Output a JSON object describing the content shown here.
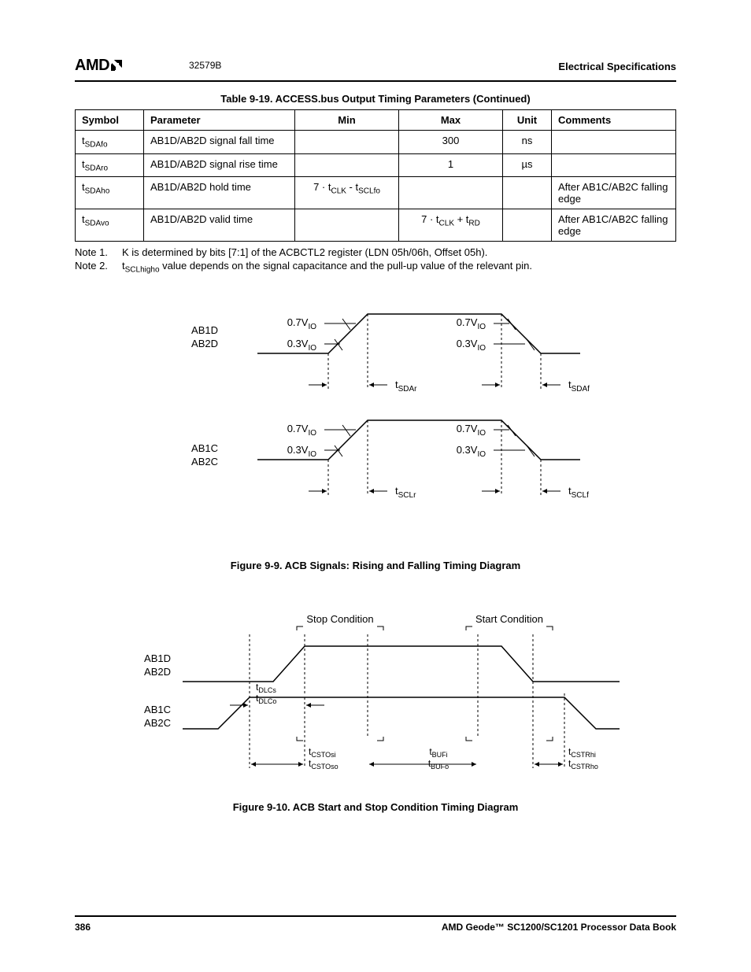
{
  "header": {
    "logo_text": "AMD",
    "doc_number": "32579B",
    "section": "Electrical Specifications"
  },
  "table": {
    "caption": "Table 9-19.  ACCESS.bus Output Timing Parameters  (Continued)",
    "headers": {
      "symbol": "Symbol",
      "parameter": "Parameter",
      "min": "Min",
      "max": "Max",
      "unit": "Unit",
      "comments": "Comments"
    },
    "rows": [
      {
        "symbol_pre": "t",
        "symbol_sub": "SDAfo",
        "parameter": "AB1D/AB2D signal fall time",
        "min": "",
        "max": "300",
        "unit": "ns",
        "comments": ""
      },
      {
        "symbol_pre": "t",
        "symbol_sub": "SDAro",
        "parameter": "AB1D/AB2D signal rise time",
        "min": "",
        "max": "1",
        "unit": "µs",
        "comments": ""
      },
      {
        "symbol_pre": "t",
        "symbol_sub": "SDAho",
        "parameter": "AB1D/AB2D hold time",
        "min_expr": {
          "a": "7 · t",
          "a_sub": "CLK",
          "op": " - t",
          "b_sub": "SCLfo"
        },
        "max": "",
        "unit": "",
        "comments": "After AB1C/AB2C falling edge"
      },
      {
        "symbol_pre": "t",
        "symbol_sub": "SDAvo",
        "parameter": "AB1D/AB2D valid time",
        "min": "",
        "max_expr": {
          "a": "7 · t",
          "a_sub": "CLK",
          "op": " + t",
          "b_sub": "RD"
        },
        "unit": "",
        "comments": "After AB1C/AB2C falling edge"
      }
    ]
  },
  "notes": {
    "n1_label": "Note 1.",
    "n1_text": "K is determined by bits [7:1] of the ACBCTL2 register (LDN 05h/06h, Offset 05h).",
    "n2_label": "Note 2.",
    "n2_pre": "t",
    "n2_sub": "SCLhigho",
    "n2_text": " value depends on the signal capacitance and the pull-up value of the relevant pin."
  },
  "figure1": {
    "caption": "Figure 9-9.  ACB Signals: Rising and Falling Timing Diagram",
    "signals": {
      "top_a": "AB1D",
      "top_b": "AB2D",
      "bot_a": "AB1C",
      "bot_b": "AB2C"
    },
    "levels": {
      "hi": "0.7V",
      "hi_sub": "IO",
      "lo": "0.3V",
      "lo_sub": "IO"
    },
    "labels": {
      "t_sdar": "SDAr",
      "t_sdaf": "SDAf",
      "t_sclr": "SCLr",
      "t_sclf": "SCLf"
    }
  },
  "figure2": {
    "caption": "Figure 9-10.  ACB Start and Stop Condition Timing Diagram",
    "top_labels": {
      "stop": "Stop Condition",
      "start": "Start Condition"
    },
    "signals": {
      "top_a": "AB1D",
      "top_b": "AB2D",
      "bot_a": "AB1C",
      "bot_b": "AB2C"
    },
    "labels": {
      "t_dlcs": "DLCs",
      "t_dlco": "DLCo",
      "t_cstosi": "CSTOsi",
      "t_cstoso": "CSTOso",
      "t_bufi": "BUFi",
      "t_bufo": "BUFo",
      "t_cstrhi": "CSTRhi",
      "t_cstrho": "CSTRho"
    }
  },
  "footer": {
    "page": "386",
    "book": "AMD Geode™ SC1200/SC1201 Processor Data Book"
  }
}
